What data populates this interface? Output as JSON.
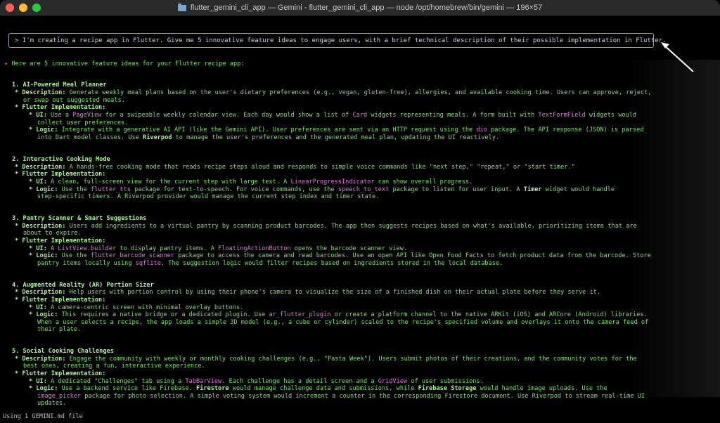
{
  "window": {
    "title": "flutter_gemini_cli_app — Gemini - flutter_gemini_cli_app — node /opt/homebrew/bin/gemini — 196×57"
  },
  "prompt": {
    "text": "> I'm creating a recipe app in Flutter. Give me 5 innovative feature ideas to engage users, with a brief technical description of their possible implementation in Flutter."
  },
  "response": {
    "bullet": "✦",
    "intro": "Here are 5 innovative feature ideas for your Flutter recipe app:",
    "l_f1_title": "1. AI-Powered Meal Planner",
    "l_f1_desc_label": "* Description:",
    "l_f1_desc_1": " Generate weekly meal plans based on the user's dietary preferences (e.g., vegan, gluten-free), allergies, and available cooking time. Users can approve, reject,",
    "l_f1_desc_2": "or swap out suggested meals.",
    "l_f1_impl": "* Flutter Implementation:",
    "l_f1_ui_label": "* UI:",
    "l_f1_ui_a": " Use a ",
    "l_f1_ui_code1": "PageView",
    "l_f1_ui_b": " for a swipeable weekly calendar view. Each day would show a list of ",
    "l_f1_ui_code2": "Card",
    "l_f1_ui_c": " widgets representing meals. A form built with ",
    "l_f1_ui_code3": "TextFormField",
    "l_f1_ui_d": " widgets would",
    "l_f1_ui_2": "collect user preferences.",
    "l_f1_logic_label": "* Logic:",
    "l_f1_logic_a": " Integrate with a generative AI API (like the Gemini API). User preferences are sent via an HTTP request using the ",
    "l_f1_logic_code1": "dio",
    "l_f1_logic_b": " package. The API response (JSON) is parsed",
    "l_f1_logic_2a": "into Dart model classes. Use ",
    "l_f1_logic_bold": "Riverpod",
    "l_f1_logic_2b": " to manage the user's preferences and the generated meal plan, updating the UI reactively.",
    "l_f2_title": "2. Interactive Cooking Mode",
    "l_f2_desc_label": "* Description:",
    "l_f2_desc_1": " A hands-free cooking mode that reads recipe steps aloud and responds to simple voice commands like \"next step,\" \"repeat,\" or \"start timer.\"",
    "l_f2_impl": "* Flutter Implementation:",
    "l_f2_ui_label": "* UI:",
    "l_f2_ui_a": " A clean, full-screen view for the current step with large text. A ",
    "l_f2_ui_code1": "LinearProgressIndicator",
    "l_f2_ui_b": " can show overall progress.",
    "l_f2_logic_label": "* Logic:",
    "l_f2_logic_a": " Use the ",
    "l_f2_logic_code1": "flutter_tts",
    "l_f2_logic_b": " package for text-to-speech. For voice commands, use the ",
    "l_f2_logic_code2": "speech_to_text",
    "l_f2_logic_c": " package to listen for user input. A ",
    "l_f2_logic_bold": "Timer",
    "l_f2_logic_d": " widget would handle",
    "l_f2_logic_2": "step-specific timers. A Riverpod provider would manage the current step index and timer state.",
    "l_f3_title": "3. Pantry Scanner & Smart Suggestions",
    "l_f3_desc_label": "* Description:",
    "l_f3_desc_1": " Users add ingredients to a virtual pantry by scanning product barcodes. The app then suggests recipes based on what's available, prioritizing items that are",
    "l_f3_desc_2": "about to expire.",
    "l_f3_impl": "* Flutter Implementation:",
    "l_f3_ui_label": "* UI:",
    "l_f3_ui_a": " A ",
    "l_f3_ui_code1": "ListView.builder",
    "l_f3_ui_b": " to display pantry items. A ",
    "l_f3_ui_code2": "FloatingActionButton",
    "l_f3_ui_c": " opens the barcode scanner view.",
    "l_f3_logic_label": "* Logic:",
    "l_f3_logic_a": " Use the ",
    "l_f3_logic_code1": "flutter_barcode_scanner",
    "l_f3_logic_b": " package to access the camera and read barcodes. Use an open API like Open Food Facts to fetch product data from the barcode. Store",
    "l_f3_logic_2a": "pantry items locally using ",
    "l_f3_logic_code2": "sqflite",
    "l_f3_logic_2b": ". The suggestion logic would filter recipes based on ingredients stored in the local database.",
    "l_f4_title": "4. Augmented Reality (AR) Portion Sizer",
    "l_f4_desc_label": "* Description:",
    "l_f4_desc_1": " Help users with portion control by using their phone's camera to visualize the size of a finished dish on their actual plate before they serve it.",
    "l_f4_impl": "* Flutter Implementation:",
    "l_f4_ui_label": "* UI:",
    "l_f4_ui_a": " A camera-centric screen with minimal overlay buttons.",
    "l_f4_logic_label": "* Logic:",
    "l_f4_logic_a": " This requires a native bridge or a dedicated plugin. Use ",
    "l_f4_logic_code1": "ar_flutter_plugin",
    "l_f4_logic_b": " or create a platform channel to the native ARKit (iOS) and ARCore (Android) libraries.",
    "l_f4_logic_2": "When a user selects a recipe, the app loads a simple 3D model (e.g., a cube or cylinder) scaled to the recipe's specified volume and overlays it onto the camera feed of",
    "l_f4_logic_3": "their plate.",
    "l_f5_title": "5. Social Cooking Challenges",
    "l_f5_desc_label": "* Description:",
    "l_f5_desc_1": " Engage the community with weekly or monthly cooking challenges (e.g., \"Pasta Week\"). Users submit photos of their creations, and the community votes for the",
    "l_f5_desc_2": "best ones, creating a fun, interactive experience.",
    "l_f5_impl": "* Flutter Implementation:",
    "l_f5_ui_label": "* UI:",
    "l_f5_ui_a": " A dedicated \"Challenges\" tab using a ",
    "l_f5_ui_code1": "TabBarView",
    "l_f5_ui_b": ". Each challenge has a detail screen and a ",
    "l_f5_ui_code2": "GridView",
    "l_f5_ui_c": " of user submissions.",
    "l_f5_logic_label": "* Logic:",
    "l_f5_logic_a": " Use a backend service like Firebase. ",
    "l_f5_logic_bold1": "Firestore",
    "l_f5_logic_b": " would manage challenge data and submissions, while ",
    "l_f5_logic_bold2": "Firebase Storage",
    "l_f5_logic_c": " would handle image uploads. Use the",
    "l_f5_logic_code1": "image_picker",
    "l_f5_logic_2": " package for photo selection. A simple voting system would increment a counter in the corresponding Firestore document. Use Riverpod to stream real-time UI",
    "l_f5_logic_3": "updates."
  },
  "status": {
    "text": "Using 1 GEMINI.md file"
  },
  "colors": {
    "text": "#7ee06c",
    "code": "#e078e0",
    "background": "#000000"
  }
}
